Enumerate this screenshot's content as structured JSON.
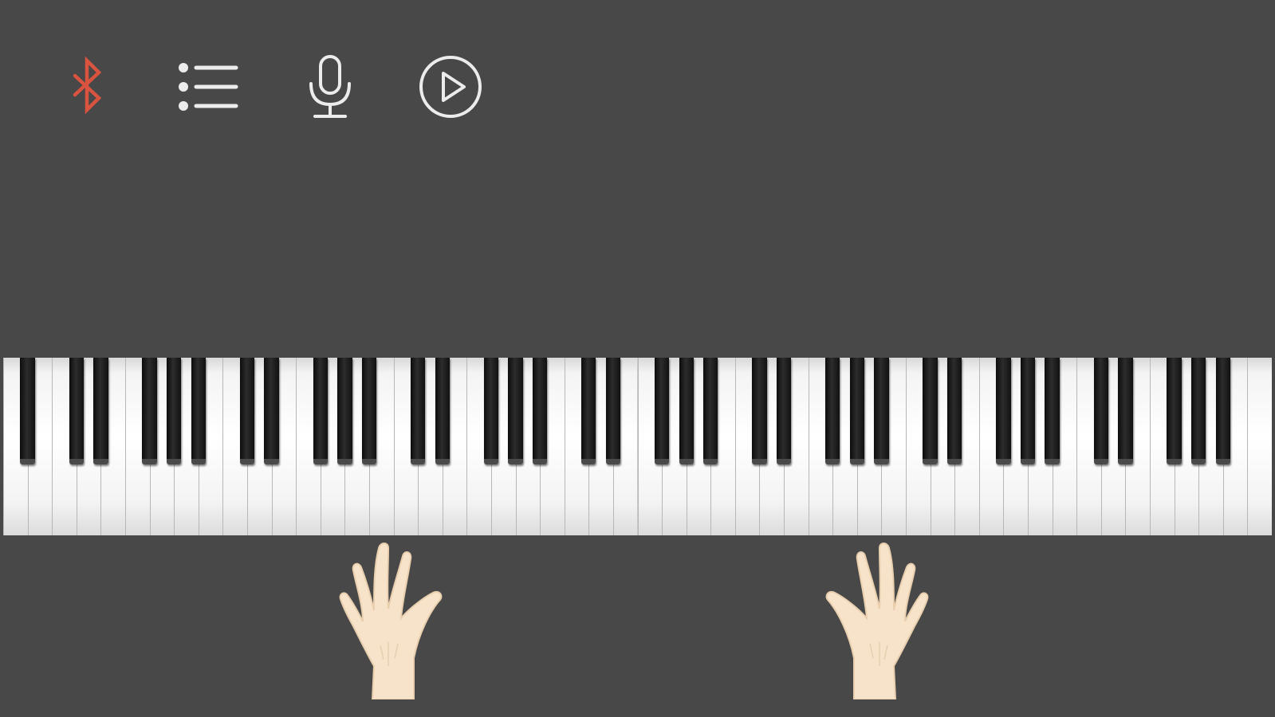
{
  "theme": {
    "background": "#484848",
    "accent_bluetooth": "#d9533f",
    "icon_color": "#ececec",
    "hand_skin": "#f6e3ca"
  },
  "toolbar": {
    "buttons": [
      {
        "id": "bluetooth",
        "icon": "bluetooth-icon",
        "active": true
      },
      {
        "id": "song-list",
        "icon": "list-icon",
        "active": false
      },
      {
        "id": "record",
        "icon": "microphone-icon",
        "active": false
      },
      {
        "id": "play",
        "icon": "play-circle-icon",
        "active": false
      }
    ]
  },
  "keyboard": {
    "white_key_count": 52,
    "black_key_count": 36,
    "first_key": "A0",
    "last_key": "C8"
  },
  "hands": [
    {
      "id": "left-hand",
      "icon": "left-hand-icon"
    },
    {
      "id": "right-hand",
      "icon": "right-hand-icon"
    }
  ]
}
